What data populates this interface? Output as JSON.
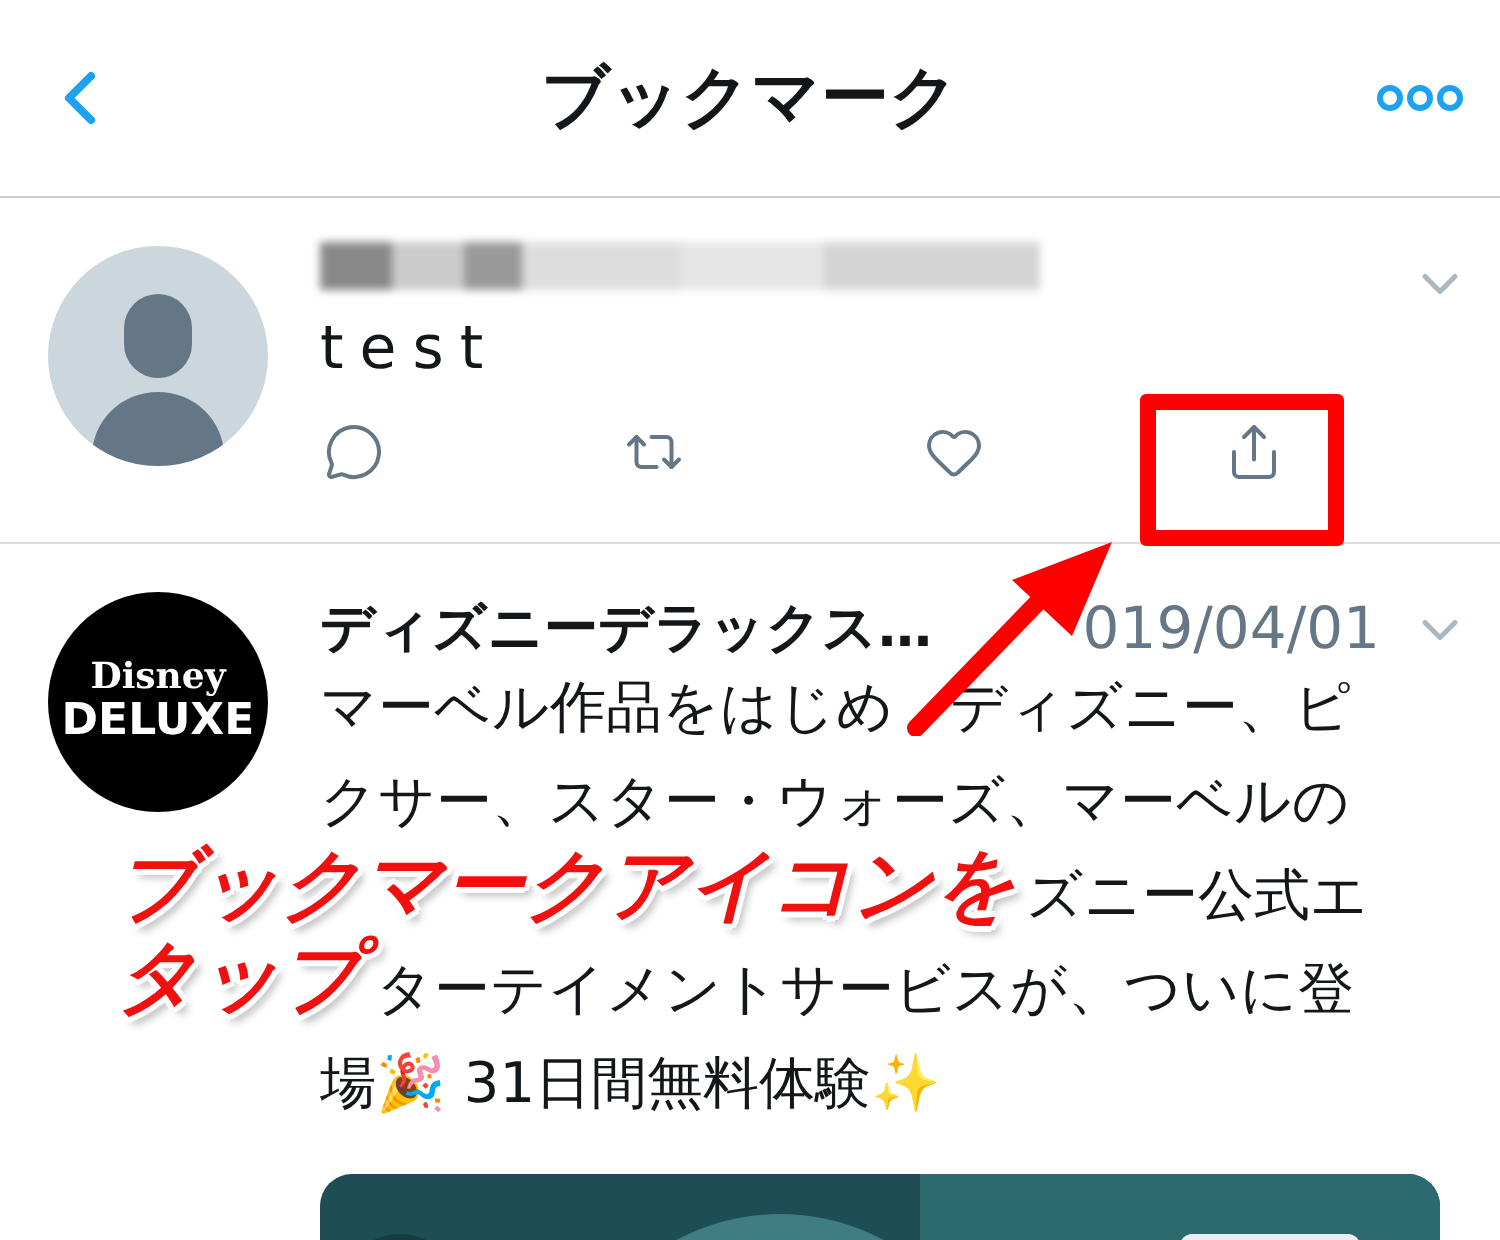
{
  "header": {
    "title": "ブックマーク"
  },
  "tweets": [
    {
      "kind": "placeholder-avatar",
      "text": "test"
    },
    {
      "kind": "logo-avatar",
      "logo": [
        "Disney",
        "DELUXE"
      ],
      "name": "ディズニーデラックス…",
      "date": "019/04/01",
      "lines": [
        [
          "マーベル作品をはじめ",
          "ディズニー、ピ"
        ],
        [
          "クサー、スター・ウォーズ、マーベルの"
        ],
        [
          "ズニー公式エ"
        ],
        [
          "ターテイメントサービスが、ついに登"
        ],
        [
          "場🎉 31日間無料体験✨"
        ]
      ],
      "media": {
        "kind": "picture"
      }
    }
  ],
  "annotation": {
    "lines": [
      "ブックマークアイコンを",
      "タップ"
    ]
  }
}
